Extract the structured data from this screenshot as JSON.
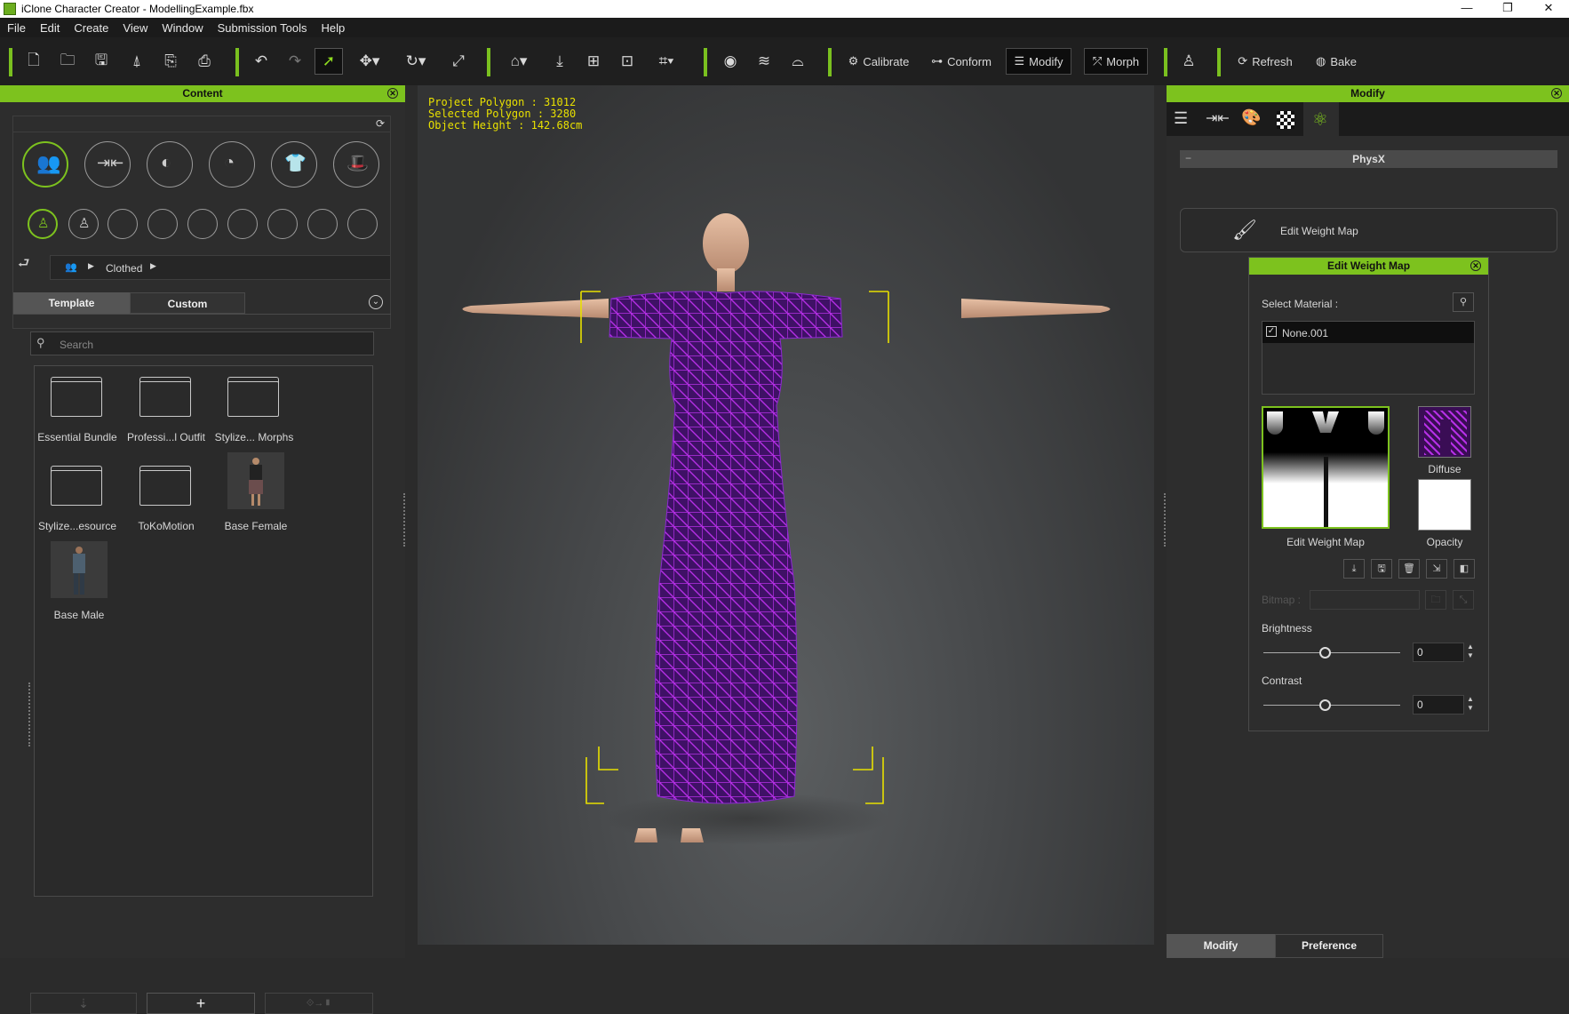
{
  "window": {
    "title": "iClone Character Creator - ModellingExample.fbx",
    "minimize": "—",
    "restore": "❐",
    "close": "✕"
  },
  "menu": [
    "File",
    "Edit",
    "Create",
    "View",
    "Window",
    "Submission Tools",
    "Help"
  ],
  "toolbar": {
    "calibrate": "Calibrate",
    "conform": "Conform",
    "modify": "Modify",
    "morph": "Morph",
    "refresh": "Refresh",
    "bake": "Bake"
  },
  "content_panel": {
    "title": "Content",
    "breadcrumb": "Clothed",
    "tabs": [
      "Template",
      "Custom"
    ],
    "search_placeholder": "Search",
    "items": [
      {
        "label": "Essential Bundle",
        "type": "folder"
      },
      {
        "label": "Professi...l Outfit",
        "type": "folder"
      },
      {
        "label": "Stylize... Morphs",
        "type": "folder"
      },
      {
        "label": "Stylize...esource",
        "type": "folder"
      },
      {
        "label": "ToKoMotion",
        "type": "folder"
      },
      {
        "label": "Base Female",
        "type": "figure"
      },
      {
        "label": "Base Male",
        "type": "figure"
      }
    ],
    "add_button": "+"
  },
  "viewport": {
    "info": {
      "project_polygon": "Project Polygon : 31012",
      "selected_polygon": "Selected Polygon : 3280",
      "object_height": "Object Height : 142.68cm"
    },
    "colors": {
      "info_text": "#e8e000",
      "mesh": "#a424d8",
      "dress": "#4a1470"
    }
  },
  "modify_panel": {
    "title": "Modify",
    "tab_icons": [
      "sliders-icon",
      "morph-slider-icon",
      "palette-icon",
      "checker-icon",
      "physx-icon"
    ],
    "section": "PhysX",
    "section_collapse": "−",
    "edit_weight_map_button": "Edit Weight Map",
    "bottom_tabs": [
      "Modify",
      "Preference"
    ]
  },
  "weight_map_dialog": {
    "title": "Edit Weight Map",
    "select_material_label": "Select Material :",
    "materials": [
      {
        "name": "None.001",
        "checked": true
      }
    ],
    "thumbnails": {
      "weight": "Edit Weight Map",
      "diffuse": "Diffuse",
      "opacity": "Opacity"
    },
    "bitmap_label": "Bitmap :",
    "brightness_label": "Brightness",
    "brightness_value": "0",
    "contrast_label": "Contrast",
    "contrast_value": "0"
  }
}
